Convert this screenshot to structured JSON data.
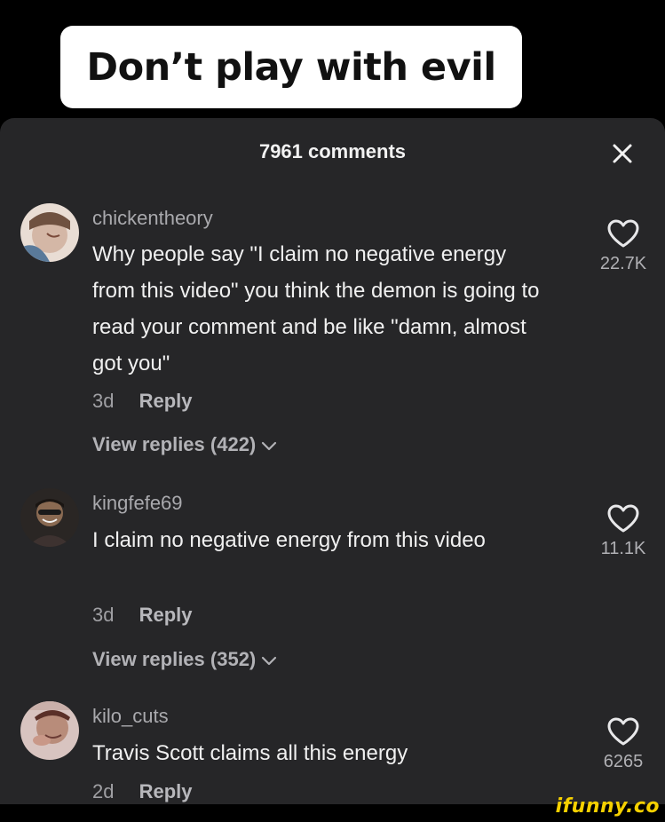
{
  "caption": "Don’t play with evil",
  "header": {
    "comment_count": "7961 comments",
    "close_icon": "close-icon"
  },
  "comments": [
    {
      "username": "chickentheory",
      "text": "Why people say \"I claim no negative energy from this video\" you think the demon is going to read your comment and be like \"damn, almost got you\"",
      "time": "3d",
      "reply_label": "Reply",
      "view_replies": "View replies (422)",
      "likes": "22.7K",
      "avatar_colors": [
        "#d9c3b6",
        "#5a7a9a"
      ]
    },
    {
      "username": "kingfefe69",
      "text": "I claim no negative energy from this video",
      "time": "3d",
      "reply_label": "Reply",
      "view_replies": "View replies (352)",
      "likes": "11.1K",
      "avatar_colors": [
        "#3b2a22",
        "#8a6a52"
      ]
    },
    {
      "username": "kilo_cuts",
      "text": "Travis Scott claims all this energy",
      "time": "2d",
      "reply_label": "Reply",
      "likes": "6265",
      "avatar_colors": [
        "#b88c7a",
        "#6b3c35"
      ]
    }
  ],
  "watermark": "ifunny.co",
  "colors": {
    "sheet_background": "#262628",
    "page_background": "#000000",
    "watermark": "#f5d000"
  }
}
